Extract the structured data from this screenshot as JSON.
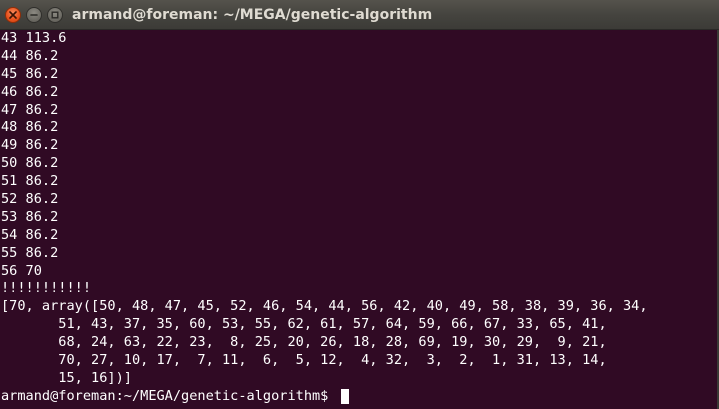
{
  "window": {
    "title": "armand@foreman: ~/MEGA/genetic-algorithm",
    "buttons": {
      "close_icon": "close-x",
      "minimize_icon": "minus",
      "maximize_icon": "square"
    }
  },
  "terminal": {
    "lines": [
      "43 113.6",
      "44 86.2",
      "45 86.2",
      "46 86.2",
      "47 86.2",
      "48 86.2",
      "49 86.2",
      "50 86.2",
      "51 86.2",
      "52 86.2",
      "53 86.2",
      "54 86.2",
      "55 86.2",
      "56 70",
      "!!!!!!!!!!!",
      "[70, array([50, 48, 47, 45, 52, 46, 54, 44, 56, 42, 40, 49, 58, 38, 39, 36, 34,",
      "       51, 43, 37, 35, 60, 53, 55, 62, 61, 57, 64, 59, 66, 67, 33, 65, 41,",
      "       68, 24, 63, 22, 23,  8, 25, 20, 26, 18, 28, 69, 19, 30, 29,  9, 21,",
      "       70, 27, 10, 17,  7, 11,  6,  5, 12,  4, 32,  3,  2,  1, 31, 13, 14,",
      "       15, 16])]"
    ],
    "prompt": "armand@foreman:~/MEGA/genetic-algorithm$ "
  },
  "colors": {
    "terminal_bg": "#300a24",
    "text": "#ffffff",
    "close_button": "#e9541f",
    "titlebar": "#45443f",
    "title_text": "#dfdbd2"
  }
}
